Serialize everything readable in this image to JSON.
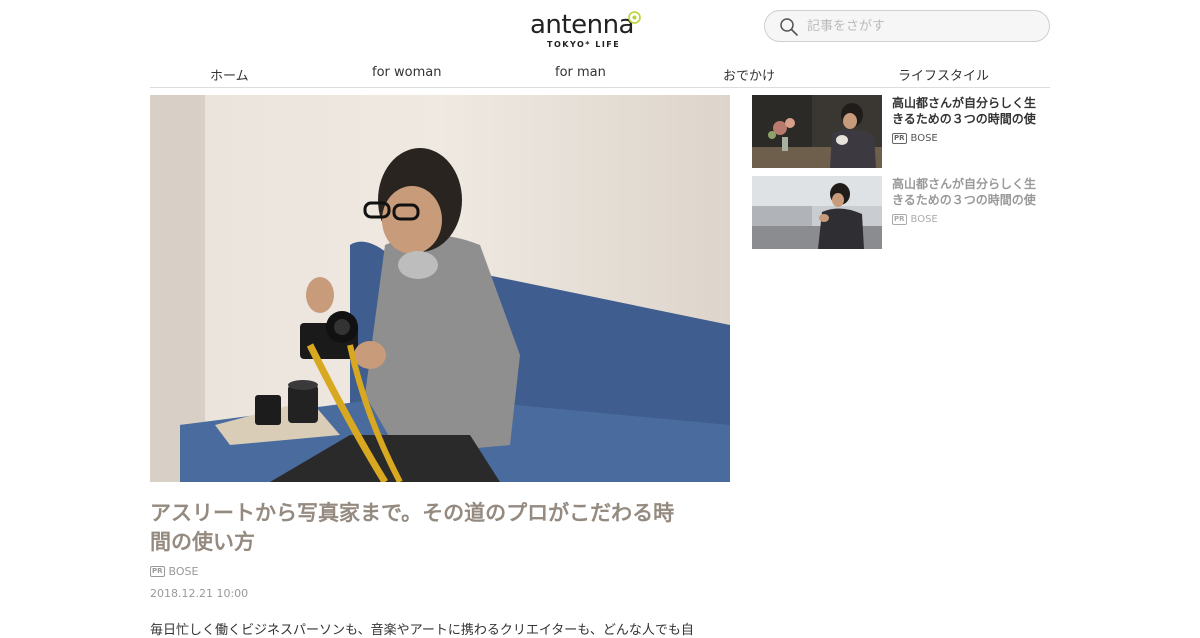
{
  "header": {
    "logo_text": "antenna",
    "logo_sub": "TOKYO* LIFE",
    "search_placeholder": "記事をさがす"
  },
  "nav": {
    "items": [
      {
        "label": "ホーム"
      },
      {
        "label": "for woman"
      },
      {
        "label": "for man"
      },
      {
        "label": "おでかけ"
      },
      {
        "label": "ライフスタイル"
      }
    ]
  },
  "main_article": {
    "title_line1": "アスリートから写真家まで。その道のプロがこだわる時",
    "title_line2": "間の使い方",
    "pr_badge": "PR",
    "sponsor": "BOSE",
    "date": "2018.12.21 10:00",
    "lead": "毎日忙しく働くビジネスパーソンも、音楽やアートに携わるクリエイターも、どんな人でも自"
  },
  "side_articles": [
    {
      "title_line1": "高山都さんが自分らしく生",
      "title_line2": "きるための３つの時間の使",
      "pr_badge": "PR",
      "sponsor": "BOSE"
    },
    {
      "title_line1": "高山都さんが自分らしく生",
      "title_line2": "きるための３つの時間の使",
      "pr_badge": "PR",
      "sponsor": "BOSE"
    }
  ],
  "colors": {
    "accent_logo": "#b8d432",
    "title_muted": "#958a80"
  }
}
